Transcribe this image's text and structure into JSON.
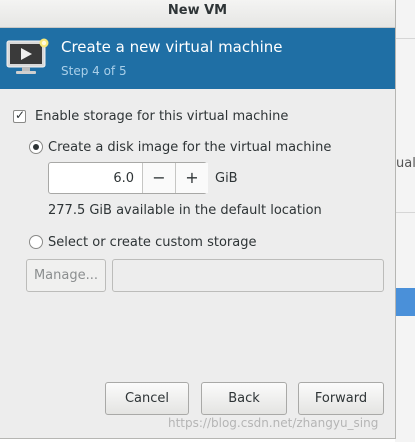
{
  "background_window": {
    "partial_text": "ual"
  },
  "window": {
    "title": "New VM"
  },
  "header": {
    "title": "Create a new virtual machine",
    "step": "Step 4 of 5",
    "icon": "vm-monitor-icon",
    "banner_color": "#1f6fa5"
  },
  "storage": {
    "enable_label": "Enable storage for this virtual machine",
    "enable_checked": true,
    "create_disk_label": "Create a disk image for the virtual machine",
    "create_disk_selected": true,
    "size_value": "6.0",
    "size_unit": "GiB",
    "decrement_label": "−",
    "increment_label": "+",
    "available_text": "277.5 GiB available in the default location",
    "custom_label": "Select or create custom storage",
    "custom_selected": false,
    "manage_label": "Manage...",
    "custom_path_value": ""
  },
  "buttons": {
    "cancel": "Cancel",
    "back": "Back",
    "forward": "Forward"
  },
  "watermark": "https://blog.csdn.net/zhangyu_sing",
  "colors": {
    "accent": "#1f6fa5",
    "dialog_bg": "#ededed"
  }
}
